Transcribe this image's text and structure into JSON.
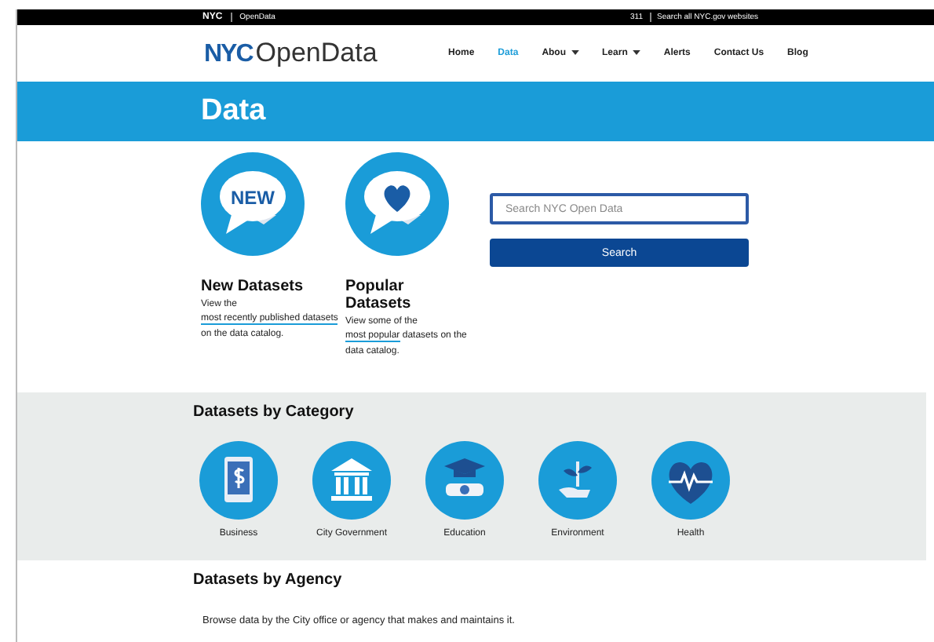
{
  "top_bar": {
    "logo": "NYC",
    "site": "OpenData",
    "phone": "311",
    "search_link": "Search all NYC.gov websites"
  },
  "header": {
    "logo_mark": "NYC",
    "logo_text": "OpenData",
    "nav": [
      {
        "label": "Home",
        "selected": false,
        "dropdown": false
      },
      {
        "label": "Data",
        "selected": true,
        "dropdown": false
      },
      {
        "label": "Abou",
        "selected": false,
        "dropdown": true
      },
      {
        "label": "Learn",
        "selected": false,
        "dropdown": true
      },
      {
        "label": "Alerts",
        "selected": false,
        "dropdown": false
      },
      {
        "label": "Contact Us",
        "selected": false,
        "dropdown": false
      },
      {
        "label": "Blog",
        "selected": false,
        "dropdown": false
      }
    ]
  },
  "banner": {
    "title": "Data"
  },
  "features": [
    {
      "kind": "new",
      "badge": "NEW",
      "title": "New Datasets",
      "before": "View the ",
      "link": "most recently published datasets",
      "after": " on the data catalog."
    },
    {
      "kind": "popular",
      "title": "Popular Datasets",
      "before": "View some of the ",
      "link": "most popular",
      "after": " datasets on the data catalog."
    }
  ],
  "search": {
    "placeholder": "Search NYC Open Data",
    "button": "Search"
  },
  "categories": {
    "title": "Datasets by Category",
    "items": [
      {
        "kind": "business",
        "label": "Business"
      },
      {
        "kind": "government",
        "label": "City Government"
      },
      {
        "kind": "education",
        "label": "Education"
      },
      {
        "kind": "environment",
        "label": "Environment"
      },
      {
        "kind": "health",
        "label": "Health"
      }
    ]
  },
  "agency": {
    "title": "Datasets by Agency",
    "text": "Browse data by the City office or agency that makes and maintains it."
  }
}
